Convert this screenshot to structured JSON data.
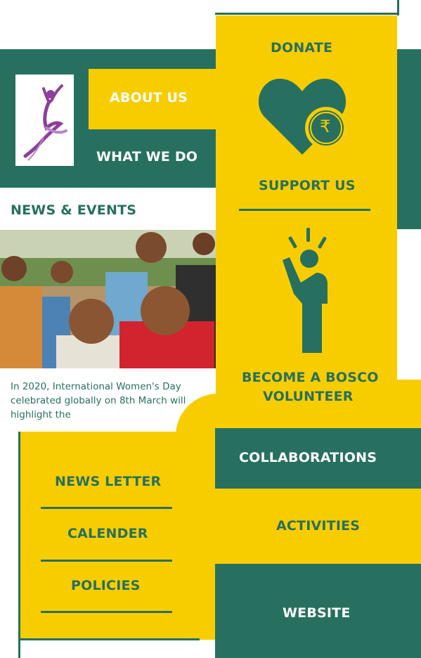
{
  "nav": {
    "about_us": "ABOUT US",
    "what_we_do": "WHAT WE DO",
    "news_events": "NEWS & EVENTS"
  },
  "news": {
    "excerpt": "In 2020, International Women's Day celebrated globally on 8th March will highlight the"
  },
  "donate": {
    "label": "DONATE",
    "support_label": "SUPPORT US",
    "currency_symbol": "₹"
  },
  "volunteer": {
    "label_line1": "BECOME A BOSCO",
    "label_line2": "VOLUNTEER"
  },
  "links": {
    "collaborations": "COLLABORATIONS",
    "activities": "ACTIVITIES",
    "website": "WEBSITE",
    "news_letter": "NEWS LETTER",
    "calender": "CALENDER",
    "policies": "POLICIES"
  },
  "colors": {
    "teal": "#27705f",
    "yellow": "#f8cd00",
    "logo_purple": "#8e3e9c"
  }
}
